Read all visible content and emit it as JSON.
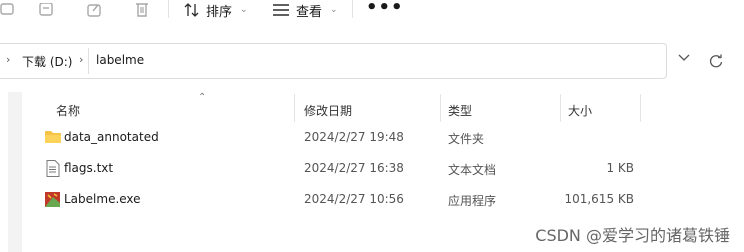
{
  "toolbar": {
    "sort_label": "排序",
    "view_label": "查看",
    "more_label": "•••"
  },
  "address": {
    "drive": "下载 (D:)",
    "folder": "labelme"
  },
  "columns": {
    "name": "名称",
    "date": "修改日期",
    "type": "类型",
    "size": "大小"
  },
  "files": [
    {
      "name": "data_annotated",
      "date": "2024/2/27 19:48",
      "type": "文件夹",
      "size": "",
      "icon": "folder-icon"
    },
    {
      "name": "flags.txt",
      "date": "2024/2/27 16:38",
      "type": "文本文档",
      "size": "1 KB",
      "icon": "text-file-icon"
    },
    {
      "name": "Labelme.exe",
      "date": "2024/2/27 10:56",
      "type": "应用程序",
      "size": "101,615 KB",
      "icon": "exe-app-icon"
    }
  ],
  "watermark": "CSDN @爱学习的诸葛铁锤",
  "colors": {
    "folder": "#f6c444",
    "accent_app": "#c0392b"
  }
}
